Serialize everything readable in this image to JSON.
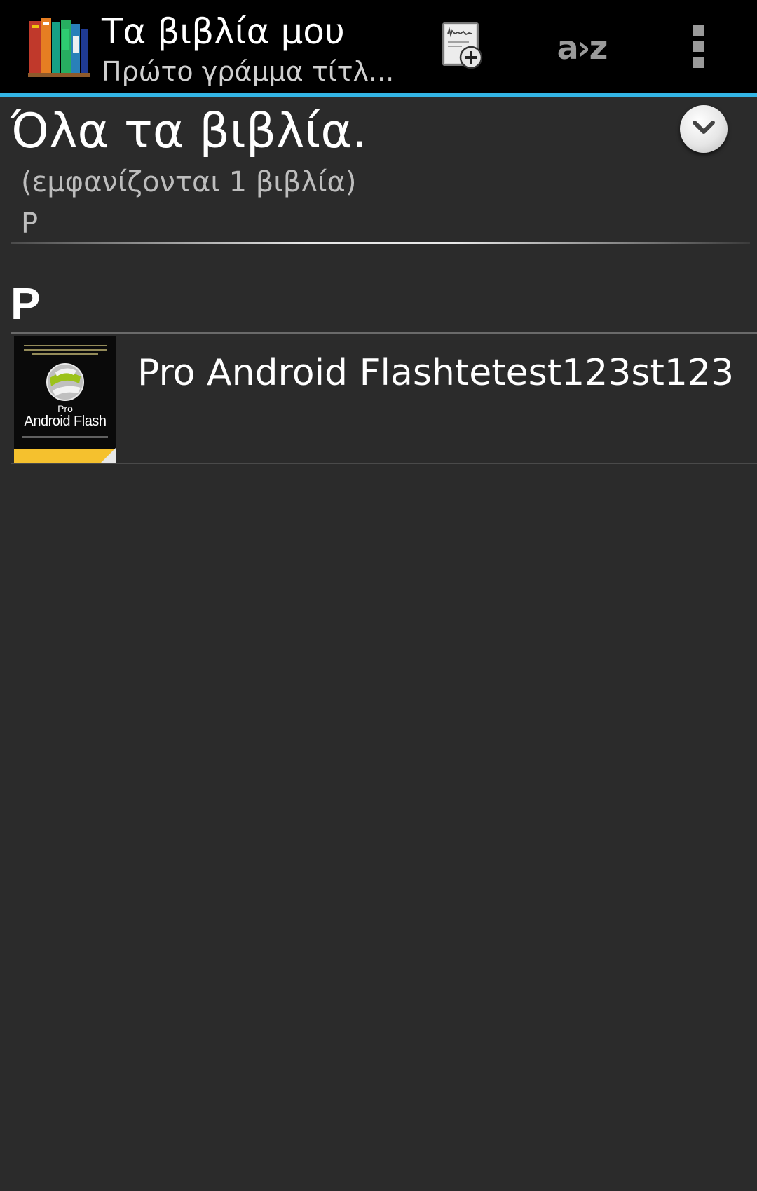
{
  "action_bar": {
    "title": "Τα βιβλία μου",
    "subtitle": "Πρώτο γράμμα τίτλ...",
    "app_icon": "bookshelf-icon",
    "add_book_icon": "add-book-icon",
    "sort_label": "a›z",
    "overflow_icon": "overflow-menu-icon",
    "accent_color": "#33b5e5"
  },
  "header": {
    "title": "Όλα τα βιβλία.",
    "count_text": "(εμφανίζονται 1 βιβλία)",
    "filter_text": "P",
    "expand_icon": "chevron-down-icon"
  },
  "sections": [
    {
      "letter": "P",
      "books": [
        {
          "title": "Pro Android Flashtetest123st123",
          "cover": {
            "small": "Pro",
            "title": "Android Flash",
            "band_color": "#f5c12e"
          }
        }
      ]
    }
  ]
}
